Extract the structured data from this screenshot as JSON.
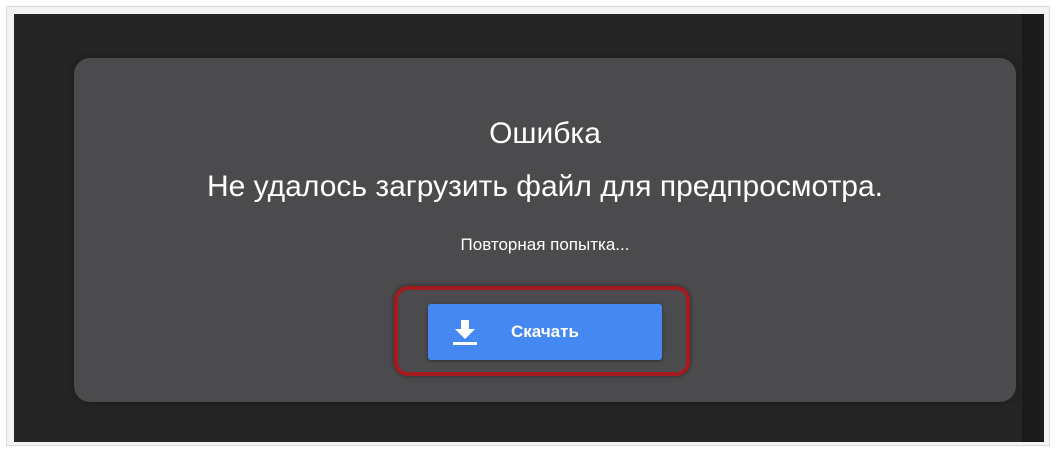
{
  "error": {
    "title": "Ошибка",
    "message": "Не удалось загрузить файл для предпросмотра.",
    "retry_text": "Повторная попытка..."
  },
  "download_button": {
    "label": "Скачать",
    "icon": "download-icon",
    "color": "#4688f1"
  },
  "highlight": {
    "color": "#a41a1e"
  },
  "colors": {
    "viewer_background": "#252525",
    "card_background": "#4b4a4c"
  }
}
